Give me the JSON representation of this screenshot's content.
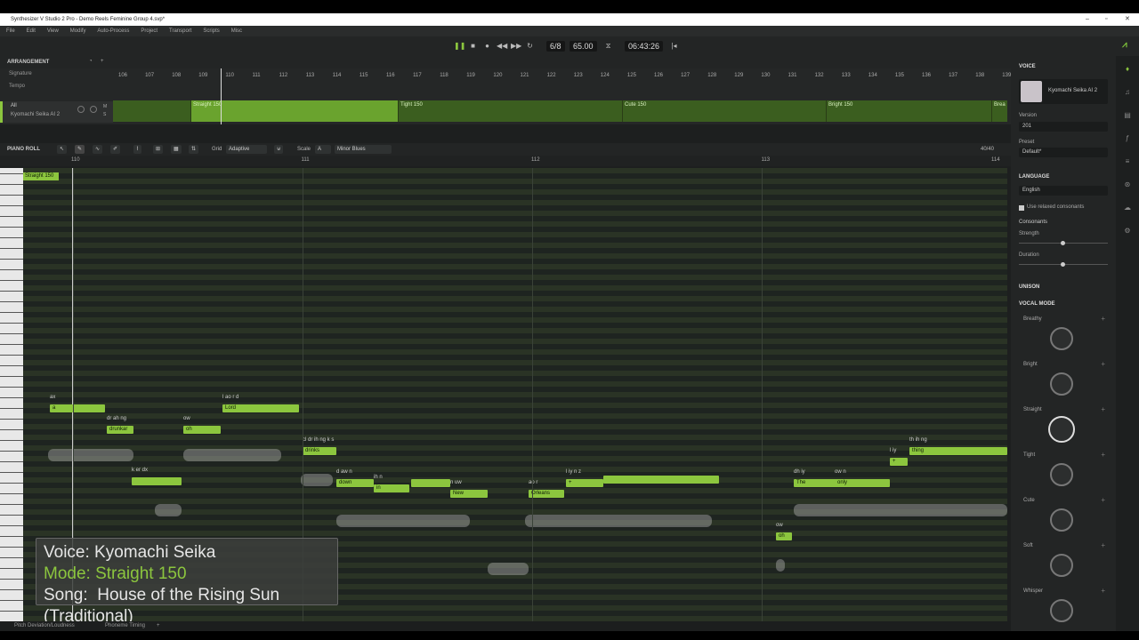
{
  "window": {
    "title": "Synthesizer V Studio 2 Pro - Demo Reels Feminine Group 4.svp*"
  },
  "menu": [
    "File",
    "Edit",
    "View",
    "Modify",
    "Auto-Process",
    "Project",
    "Transport",
    "Scripts",
    "Misc"
  ],
  "transport": {
    "time_signature": "6/8",
    "tempo": "65.00",
    "timecode": "06:43:26"
  },
  "arrangement": {
    "title": "ARRANGEMENT",
    "ruler": [
      "106",
      "107",
      "108",
      "109",
      "110",
      "111",
      "112",
      "113",
      "114",
      "115",
      "116",
      "117",
      "118",
      "119",
      "120",
      "121",
      "122",
      "123",
      "124",
      "125",
      "126",
      "127",
      "128",
      "129",
      "130",
      "131",
      "132",
      "133",
      "134",
      "135",
      "136",
      "137",
      "138",
      "139"
    ],
    "signature_label": "Signature",
    "tempo_label": "Tempo",
    "track_all": "All",
    "track_name": "Kyomachi Seika AI 2",
    "segments": [
      "Straight 150",
      "Tight 150",
      "Cute 150",
      "Bright 150",
      "Brea"
    ]
  },
  "piano_roll": {
    "title": "PIANO ROLL",
    "grid_label": "Grid",
    "grid_value": "Adaptive",
    "scale_label": "Scale",
    "scale_key": "A",
    "scale_type": "Minor Blues",
    "count": "40/40",
    "ruler": [
      "110",
      "111",
      "112",
      "113",
      "114"
    ],
    "group_tag": "Straight 150",
    "notes": [
      {
        "lyric": "a",
        "phon": "ax"
      },
      {
        "lyric": "drunkar",
        "phon": "dr ah ng"
      },
      {
        "lyric": "",
        "phon": "k er dx"
      },
      {
        "lyric": "oh",
        "phon": "ow"
      },
      {
        "lyric": "Lord",
        "phon": "l ao r d"
      },
      {
        "lyric": "drinks",
        "phon": "cl dr ih ng k s"
      },
      {
        "lyric": "down",
        "phon": "d aw n"
      },
      {
        "lyric": "in",
        "phon": "ih n"
      },
      {
        "lyric": "New",
        "phon": "n uw"
      },
      {
        "lyric": "Orleans",
        "phon": "ao r"
      },
      {
        "lyric": "+",
        "phon": "l iy n z"
      },
      {
        "lyric": "oh",
        "phon": "ow"
      },
      {
        "lyric": "The",
        "phon": "dh iy"
      },
      {
        "lyric": "only",
        "phon": "ow n"
      },
      {
        "lyric": "+",
        "phon": "l iy"
      },
      {
        "lyric": "thing",
        "phon": "th ih ng"
      }
    ]
  },
  "overlay": {
    "voice": "Voice: Kyomachi Seika",
    "mode": "Mode: Straight 150",
    "song_label": "Song:",
    "song": "House of the Rising Sun (Traditional)"
  },
  "bottom": {
    "tab1": "Pitch Deviation/Loudness",
    "tab2": "Phoneme Timing"
  },
  "voice_panel": {
    "title": "VOICE",
    "voice_name": "Kyomachi Seika AI 2",
    "version_label": "Version",
    "version": "201",
    "preset_label": "Preset",
    "preset": "Default*",
    "language_title": "LANGUAGE",
    "language": "English",
    "relaxed": "Use relaxed consonants",
    "consonants": "Consonants",
    "strength": "Strength",
    "duration": "Duration",
    "unison_title": "UNISON",
    "vocal_mode_title": "VOCAL MODE",
    "modes": [
      "Breathy",
      "Bright",
      "Straight",
      "Tight",
      "Cute",
      "Soft",
      "Whisper"
    ]
  }
}
